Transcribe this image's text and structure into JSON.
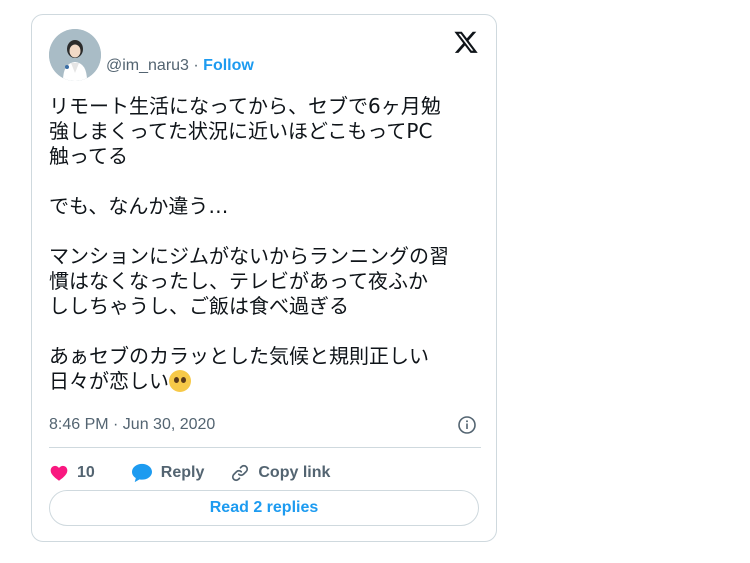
{
  "tweet": {
    "handle": "@im_naru3",
    "separator": " · ",
    "follow_label": "Follow",
    "text": "リモート生活になってから、セブで6ヶ月勉\n強しまくってた状況に近いほどこもってPC\n触ってる\n\nでも、なんか違う…\n\nマンションにジムがないからランニングの習\n慣はなくなったし、テレビがあって夜ふか\nししちゃうし、ご飯は食べ過ぎる\n\nあぁセブのカラッとした気候と規則正しい\n日々が恋しい",
    "emoji": "pleading-face",
    "timestamp": "8:46 PM · Jun 30, 2020"
  },
  "actions": {
    "like_count": "10",
    "reply_label": "Reply",
    "copy_link_label": "Copy link"
  },
  "read_replies_label": "Read 2 replies",
  "colors": {
    "accent": "#1d9bf0",
    "like": "#f91880",
    "text": "#0f1419",
    "muted": "#536471",
    "border": "#cfd9de"
  }
}
